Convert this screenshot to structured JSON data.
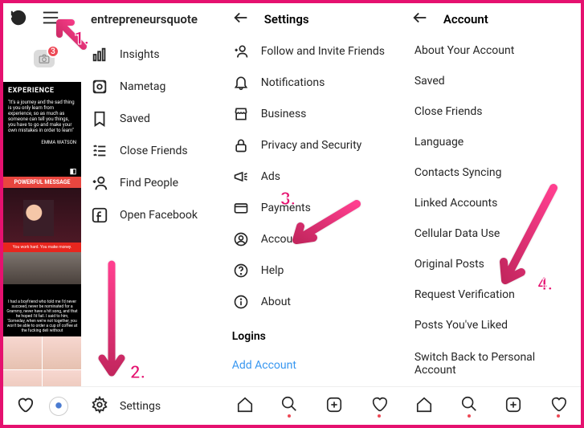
{
  "annotations": {
    "n1": "1.",
    "n2": "2.",
    "n3": "3.",
    "n4": "4."
  },
  "feed": {
    "story_badge": "3",
    "posts": {
      "experience": {
        "title": "EXPERIENCE",
        "body": "\"It's a journey and the sad thing is you only learn from experience, so as much as someone can tell you things, you have to go and make your own mistakes in order to learn\"",
        "author": "EMMA WATSON"
      },
      "powerful": {
        "label": "POWERFUL MESSAGE",
        "caption": "You work hard. You make money."
      },
      "gala": {
        "caption": "I had a boyfriend who told me I'd never succeed, never be nominated for a Grammy, never have a hit song, and that he hoped I'd fail. I said to him, 'Someday, when we're not together, you won't be able to order a cup of coffee at the fucking deli without"
      }
    }
  },
  "drawer": {
    "username": "entrepreneursquote",
    "items": [
      {
        "label": "Insights"
      },
      {
        "label": "Nametag"
      },
      {
        "label": "Saved"
      },
      {
        "label": "Close Friends"
      },
      {
        "label": "Find People"
      },
      {
        "label": "Open Facebook"
      }
    ],
    "footer": "Settings"
  },
  "settings": {
    "title": "Settings",
    "items": [
      {
        "label": "Follow and Invite Friends"
      },
      {
        "label": "Notifications"
      },
      {
        "label": "Business"
      },
      {
        "label": "Privacy and Security"
      },
      {
        "label": "Ads"
      },
      {
        "label": "Payments"
      },
      {
        "label": "Account"
      },
      {
        "label": "Help"
      },
      {
        "label": "About"
      }
    ],
    "logins_label": "Logins",
    "add_account": "Add Account"
  },
  "account": {
    "title": "Account",
    "items": [
      "About Your Account",
      "Saved",
      "Close Friends",
      "Language",
      "Contacts Syncing",
      "Linked Accounts",
      "Cellular Data Use",
      "Original Posts",
      "Request Verification",
      "Posts You've Liked"
    ],
    "switch": "Switch Back to Personal Account"
  }
}
